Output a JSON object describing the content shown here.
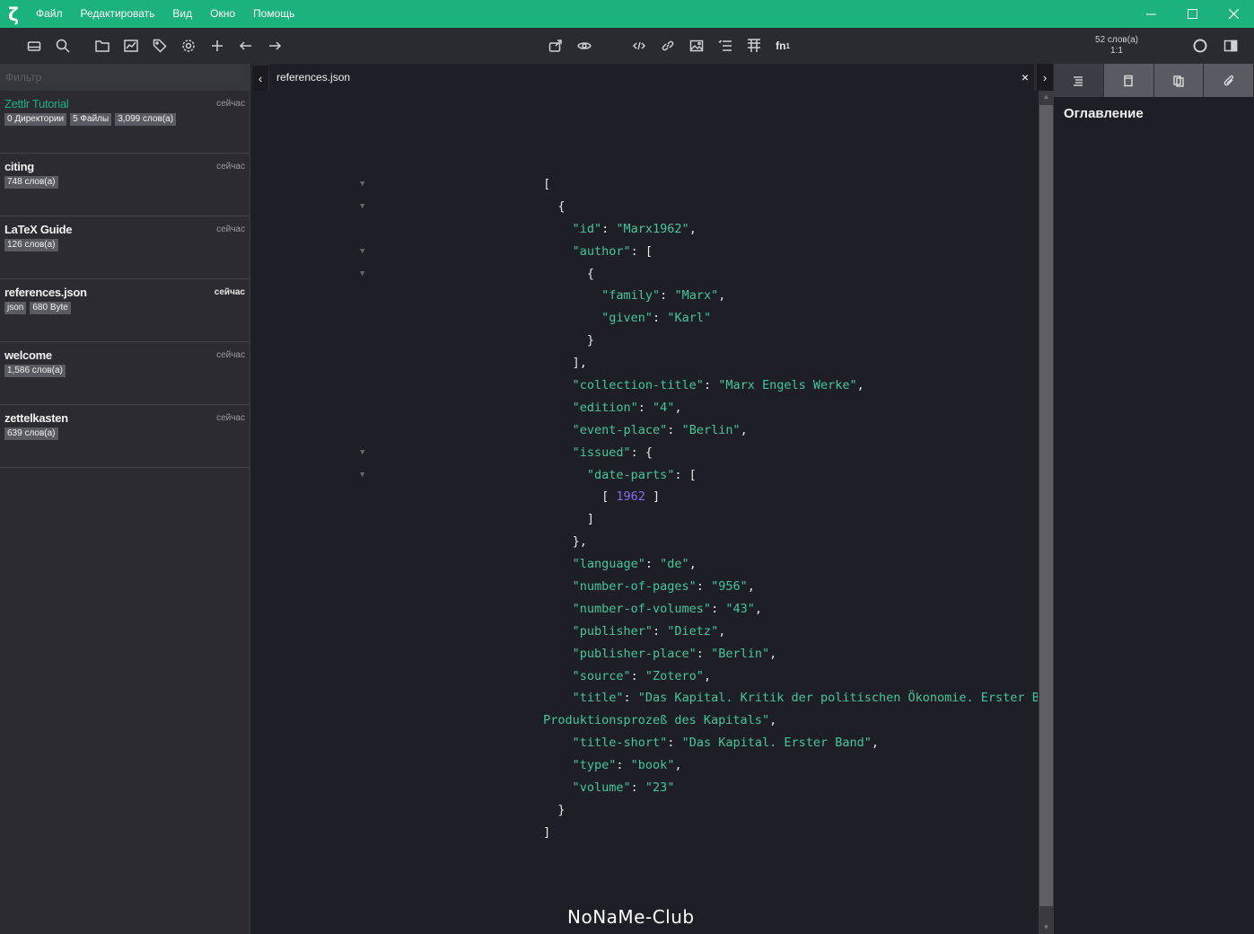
{
  "menu": [
    "Файл",
    "Редактировать",
    "Вид",
    "Окно",
    "Помощь"
  ],
  "toolbar": {
    "word_count": "52 слов(а)",
    "position": "1:1",
    "footnote_label": "fn"
  },
  "filter": {
    "placeholder": "Фильтр"
  },
  "files": [
    {
      "name": "Zettlr Tutorial",
      "time": "сейчас",
      "badges": [
        "0 Директории",
        "5 Файлы",
        "3,099 слов(а)"
      ]
    },
    {
      "name": "citing",
      "time": "сейчас",
      "badges": [
        "748 слов(а)"
      ]
    },
    {
      "name": "LaTeX Guide",
      "time": "сейчас",
      "badges": [
        "126 слов(а)"
      ]
    },
    {
      "name": "references.json",
      "time": "сейчас",
      "badges": [
        "json",
        "680 Byte"
      ]
    },
    {
      "name": "welcome",
      "time": "сейчас",
      "badges": [
        "1,586 слов(а)"
      ]
    },
    {
      "name": "zettelkasten",
      "time": "сейчас",
      "badges": [
        "639 слов(а)"
      ]
    }
  ],
  "tab": {
    "title": "references.json",
    "close": "×"
  },
  "json": {
    "id_key": "\"id\"",
    "id_val": "\"Marx1962\"",
    "author_key": "\"author\"",
    "family_key": "\"family\"",
    "family_val": "\"Marx\"",
    "given_key": "\"given\"",
    "given_val": "\"Karl\"",
    "ct_key": "\"collection-title\"",
    "ct_val": "\"Marx Engels Werke\"",
    "edition_key": "\"edition\"",
    "edition_val": "\"4\"",
    "ep_key": "\"event-place\"",
    "ep_val": "\"Berlin\"",
    "issued_key": "\"issued\"",
    "dp_key": "\"date-parts\"",
    "year": "1962",
    "lang_key": "\"language\"",
    "lang_val": "\"de\"",
    "nop_key": "\"number-of-pages\"",
    "nop_val": "\"956\"",
    "nov_key": "\"number-of-volumes\"",
    "nov_val": "\"43\"",
    "pub_key": "\"publisher\"",
    "pub_val": "\"Dietz\"",
    "pp_key": "\"publisher-place\"",
    "pp_val": "\"Berlin\"",
    "src_key": "\"source\"",
    "src_val": "\"Zotero\"",
    "title_key": "\"title\"",
    "title_val_1": "\"Das Kapital. Kritik der politischen Ökonomie. Erster Band: Der",
    "title_val_2": "Produktionsprozeß des Kapitals\"",
    "ts_key": "\"title-short\"",
    "ts_val": "\"Das Kapital. Erster Band\"",
    "type_key": "\"type\"",
    "type_val": "\"book\"",
    "vol_key": "\"volume\"",
    "vol_val": "\"23\""
  },
  "watermark": "NoNaMe-Club",
  "right_panel": {
    "title": "Оглавление"
  },
  "colors": {
    "accent": "#1cb27e",
    "editor_bg": "#1e1e26",
    "string": "#41c79a",
    "number": "#8a6bf0"
  }
}
